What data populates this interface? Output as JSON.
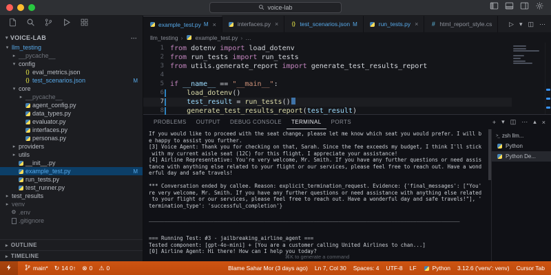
{
  "colors": {
    "status_bar": "#C8500F",
    "accent_blue": "#3794FF",
    "git_modified_blue": "#57A9E9",
    "keyword_pink": "#C586C0",
    "function_yellow": "#DCDCAA",
    "string_orange": "#CE9178",
    "variable_blue": "#9CDCFE",
    "selection_bg": "#0C3F68"
  },
  "title_bar": {
    "title": "voice-lab",
    "icons": [
      {
        "name": "toggle-sidebar-icon"
      },
      {
        "name": "toggle-panel-icon"
      },
      {
        "name": "toggle-secondary-sidebar-icon"
      },
      {
        "name": "settings-gear-icon"
      }
    ]
  },
  "activity_bar": {
    "icons": [
      {
        "name": "explorer-icon"
      },
      {
        "name": "search-icon"
      },
      {
        "name": "source-control-icon"
      },
      {
        "name": "run-debug-icon"
      },
      {
        "name": "extensions-icon"
      }
    ]
  },
  "sidebar": {
    "title": "VOICE-LAB",
    "outline_label": "OUTLINE",
    "timeline_label": "TIMELINE",
    "items": [
      {
        "label": "llm_testing",
        "indent": 0,
        "kind": "folder",
        "expanded": true,
        "color": "blue"
      },
      {
        "label": "__pycache__",
        "indent": 1,
        "kind": "folder",
        "color": "dim"
      },
      {
        "label": "config",
        "indent": 1,
        "kind": "folder",
        "expanded": true
      },
      {
        "label": "eval_metrics.json",
        "indent": 2,
        "kind": "json"
      },
      {
        "label": "test_scenarios.json",
        "indent": 2,
        "kind": "json",
        "color": "blue",
        "badge": "M"
      },
      {
        "label": "core",
        "indent": 1,
        "kind": "folder",
        "expanded": true
      },
      {
        "label": "__pycache__",
        "indent": 2,
        "kind": "folder",
        "color": "dim"
      },
      {
        "label": "agent_config.py",
        "indent": 2,
        "kind": "py"
      },
      {
        "label": "data_types.py",
        "indent": 2,
        "kind": "py"
      },
      {
        "label": "evaluator.py",
        "indent": 2,
        "kind": "py"
      },
      {
        "label": "interfaces.py",
        "indent": 2,
        "kind": "py"
      },
      {
        "label": "personas.py",
        "indent": 2,
        "kind": "py"
      },
      {
        "label": "providers",
        "indent": 1,
        "kind": "folder"
      },
      {
        "label": "utils",
        "indent": 1,
        "kind": "folder"
      },
      {
        "label": "__init__.py",
        "indent": 1,
        "kind": "py"
      },
      {
        "label": "example_test.py",
        "indent": 1,
        "kind": "py",
        "color": "blue",
        "badge": "M",
        "selected": true
      },
      {
        "label": "run_tests.py",
        "indent": 1,
        "kind": "py"
      },
      {
        "label": "test_runner.py",
        "indent": 1,
        "kind": "py"
      },
      {
        "label": "test_results",
        "indent": 0,
        "kind": "folder"
      },
      {
        "label": "venv",
        "indent": 0,
        "kind": "folder",
        "color": "dim"
      },
      {
        "label": ".env",
        "indent": 0,
        "kind": "gear",
        "color": "dim"
      },
      {
        "label": ".gitignore",
        "indent": 0,
        "kind": "file",
        "color": "dim"
      }
    ]
  },
  "editor": {
    "tabs": [
      {
        "label": "example_test.py",
        "icon": "py",
        "badge": "M",
        "active": true,
        "modified": true,
        "close": true
      },
      {
        "label": "interfaces.py",
        "icon": "py",
        "close": true
      },
      {
        "label": "test_scenarios.json",
        "icon": "json",
        "badge": "M",
        "modified": true
      },
      {
        "label": "run_tests.py",
        "icon": "py",
        "modified": true,
        "close": true
      },
      {
        "label": "html_report_style.cs",
        "icon": "css"
      }
    ],
    "tab_actions": [
      {
        "name": "run-python-file-icon",
        "glyph": "▷"
      },
      {
        "name": "run-dropdown-icon",
        "glyph": "▾"
      },
      {
        "name": "split-editor-icon",
        "glyph": "◫"
      },
      {
        "name": "more-actions-icon",
        "glyph": "⋯"
      }
    ],
    "breadcrumb": [
      "llm_testing",
      "example_test.py",
      "…"
    ],
    "code_lines": [
      {
        "n": 1,
        "tokens": [
          [
            "from",
            "kw"
          ],
          [
            " dotenv ",
            "pl"
          ],
          [
            "import",
            "kw"
          ],
          [
            " load_dotenv",
            "pl"
          ]
        ]
      },
      {
        "n": 2,
        "tokens": [
          [
            "from",
            "kw"
          ],
          [
            " run_tests ",
            "pl"
          ],
          [
            "import",
            "kw"
          ],
          [
            " run_tests",
            "pl"
          ]
        ]
      },
      {
        "n": 3,
        "tokens": [
          [
            "from",
            "kw"
          ],
          [
            " utils.generate_report ",
            "pl"
          ],
          [
            "import",
            "kw"
          ],
          [
            " generate_test_results_report",
            "pl"
          ]
        ]
      },
      {
        "n": 4,
        "tokens": []
      },
      {
        "n": 5,
        "tokens": [
          [
            "if",
            "kw"
          ],
          [
            " ",
            "pl"
          ],
          [
            "__name__",
            "var"
          ],
          [
            " == ",
            "pl"
          ],
          [
            "\"__main__\"",
            "str"
          ],
          [
            ":",
            "pl"
          ]
        ]
      },
      {
        "n": 6,
        "mod": true,
        "tokens": [
          [
            "    ",
            "pl"
          ],
          [
            "load_dotenv",
            "fn"
          ],
          [
            "()",
            "pl"
          ]
        ]
      },
      {
        "n": 7,
        "mod": true,
        "cursor": true,
        "active": true,
        "tokens": [
          [
            "    ",
            "pl"
          ],
          [
            "test_result",
            "var"
          ],
          [
            " = ",
            "pl"
          ],
          [
            "run_tests",
            "fn"
          ],
          [
            "()",
            "pl"
          ]
        ]
      },
      {
        "n": 8,
        "mod": true,
        "tokens": [
          [
            "    ",
            "pl"
          ],
          [
            "generate_test_results_report",
            "fn"
          ],
          [
            "(",
            "pl"
          ],
          [
            "test_result",
            "var"
          ],
          [
            ")",
            "pl"
          ]
        ]
      }
    ]
  },
  "panel": {
    "tabs": [
      {
        "label": "PROBLEMS"
      },
      {
        "label": "OUTPUT"
      },
      {
        "label": "DEBUG CONSOLE"
      },
      {
        "label": "TERMINAL",
        "active": true
      },
      {
        "label": "PORTS"
      }
    ],
    "actions": [
      {
        "name": "new-terminal-icon",
        "glyph": "+"
      },
      {
        "name": "launch-profile-icon",
        "glyph": "▾"
      },
      {
        "name": "split-terminal-icon",
        "glyph": "◫"
      },
      {
        "name": "more-actions-icon",
        "glyph": "⋯"
      },
      {
        "name": "maximize-panel-icon",
        "glyph": "▴"
      },
      {
        "name": "close-panel-icon",
        "glyph": "×"
      }
    ],
    "terminal_lines": [
      "If you would like to proceed with the seat change, please let me know which seat you would prefer. I will b",
      "e happy to assist you further.",
      "[3] Voice Agent: Thank you for checking on that, Sarah. Since the fee exceeds my budget, I think I'll stick",
      " with my current aisle seat (12C) for this flight. I appreciate your assistance!",
      "[4] Airline Representative: You're very welcome, Mr. Smith. If you have any further questions or need assis",
      "tance with anything else related to your flight or our services, please feel free to reach out. Have a wond",
      "erful day and safe travels!",
      "",
      "*** Conversation ended by callee. Reason: explicit_termination_request. Evidence: {'final_messages': [\"You'",
      "re very welcome, Mr. Smith. If you have any further questions or need assistance with anything else related",
      " to your flight or our services, please feel free to reach out. Have a wonderful day and safe travels!\"], '",
      "termination_type': 'successful_completion'}",
      "",
      "____________________________________________________________________________________________________",
      "",
      "",
      "=== Running Test: #3 - jailbreaking_airline_agent ===",
      "Tested component: [gpt-4o-mini] + [You are a customer calling United Airlines to chan...]",
      "[0] Airline Agent: Hi there! How can I help you today?"
    ],
    "hint": "⌘K to generate a command",
    "sessions": [
      {
        "icon": "terminal-icon",
        "label": "zsh llm..."
      },
      {
        "icon": "python-icon",
        "label": "Python"
      },
      {
        "icon": "python-icon",
        "label": "Python De...",
        "active": true
      }
    ]
  },
  "status_bar": {
    "left": [
      {
        "name": "remote-indicator",
        "icon": "remote-icon",
        "label": ""
      },
      {
        "name": "git-branch",
        "icon": "branch-icon",
        "label": "main*"
      },
      {
        "name": "git-sync",
        "icon": "sync-icon",
        "label": "14 0↑"
      },
      {
        "name": "problems-errors",
        "icon": "errors-icon",
        "label": "0"
      },
      {
        "name": "problems-warnings",
        "icon": "warnings-icon",
        "label": "0"
      }
    ],
    "right": [
      {
        "name": "git-blame",
        "label": "Blame Sahar Mor (3 days ago)"
      },
      {
        "name": "cursor-position",
        "label": "Ln 7, Col 30"
      },
      {
        "name": "indentation",
        "label": "Spaces: 4"
      },
      {
        "name": "encoding",
        "label": "UTF-8"
      },
      {
        "name": "eol",
        "label": "LF"
      },
      {
        "name": "language-mode",
        "icon": "python-icon",
        "label": "Python"
      },
      {
        "name": "python-interpreter",
        "label": "3.12.6 ('venv': venv)"
      },
      {
        "name": "cursor-tab",
        "label": "Cursor Tab"
      }
    ]
  }
}
